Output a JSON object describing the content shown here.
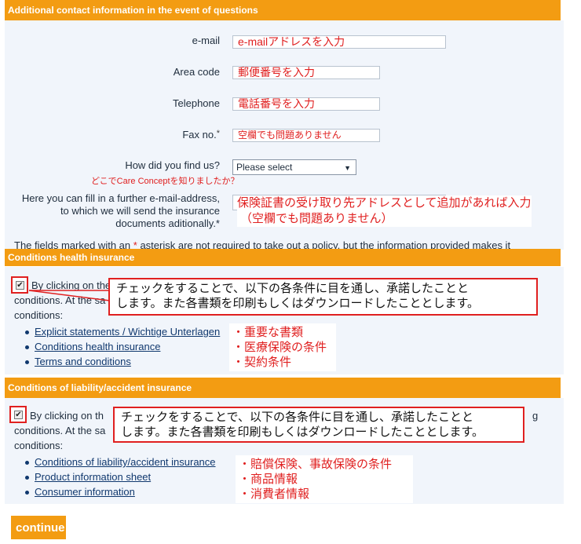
{
  "contact": {
    "title": "Additional contact information in the event of questions",
    "email_label": "e-mail",
    "email_value": "e-mailアドレスを入力",
    "area_label": "Area code",
    "area_value": "郵便番号を入力",
    "phone_label": "Telephone",
    "phone_value": "電話番号を入力",
    "fax_label": "Fax no.",
    "fax_star": "*",
    "fax_value": "空欄でも問題ありません",
    "find_label": "How did you find us?",
    "find_select": "Please select",
    "find_note": "どこでCare Conceptを知りましたか？",
    "extra_line1": "Here you can fill in a further e-mail-address,",
    "extra_line2": "to which we will send the insurance",
    "extra_line3": "documents aditionally.*",
    "extra_note_line1": "保険証書の受け取り先アドレスとして追加があれば入力",
    "extra_note_line2": "（空欄でも問題ありません）",
    "fields_note_prefix": "The fields marked with an",
    "fields_note_star": "*",
    "fields_note_suffix": "asterisk are not required to take out a policy, but the information provided makes it"
  },
  "health": {
    "title": "Conditions health insurance",
    "checked": true,
    "under_text1": "By clicking on the",
    "under_text2": "conditions. At the sa",
    "under_text3": "conditions:",
    "callout_line1": "チェックをすることで、以下の各条件に目を通し、承諾したことと",
    "callout_line2": "します。また各書類を印刷もしくはダウンロードしたこととします。",
    "links": [
      "Explicit statements / Wichtige Unterlagen",
      "Conditions health insurance",
      "Terms and conditions"
    ],
    "notes": [
      "・重要な書類",
      "・医療保険の条件",
      "・契約条件"
    ]
  },
  "liability": {
    "title": "Conditions of liability/accident insurance",
    "checked": true,
    "under_text1": "By clicking on th",
    "under_text2": "conditions. At the sa",
    "under_text3": "conditions:",
    "under_tail": "g",
    "callout_line1": "チェックをすることで、以下の各条件に目を通し、承諾したことと",
    "callout_line2": "します。また各書類を印刷もしくはダウンロードしたこととします。",
    "links": [
      "Conditions of liability/accident insurance",
      "Product information sheet",
      "Consumer information"
    ],
    "notes": [
      "・賠償保険、事故保険の条件",
      "・商品情報",
      "・消費者情報"
    ]
  },
  "continue_label": "continue",
  "colors": {
    "accent": "#f39c12",
    "annotation": "#e02020",
    "link": "#10386e"
  }
}
